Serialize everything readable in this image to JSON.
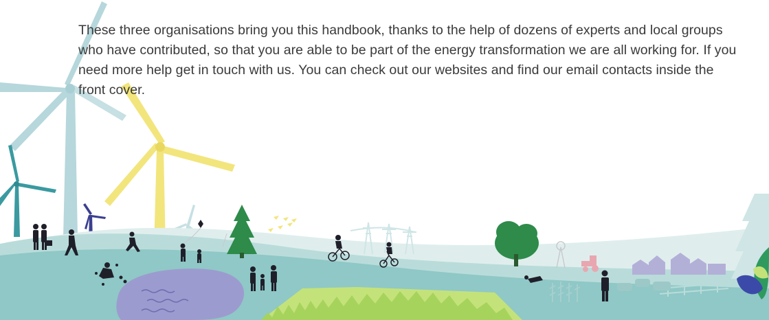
{
  "intro": {
    "text": "These three organisations bring you this handbook, thanks to the help of dozens of experts and local groups who have contributed, so that you are able to be part of the energy transformation we are all working for. If you need more help get in touch with us. You can check out our websites and find our email contacts inside the front cover."
  },
  "colors": {
    "page_background": "#ffffff",
    "text": "#3a3a3a",
    "sky_turbine": "#b6d7db",
    "yellow_turbine": "#f2e57c",
    "teal_turbine": "#3a9aa0",
    "navy_turbine": "#3b3f8f",
    "hill_back": "#dfeeed",
    "hill_mid": "#b9dcda",
    "hill_front": "#8fc8c6",
    "field_green": "#c4e27a",
    "pond": "#9c9bcf",
    "tree": "#2e8b4a",
    "house": "#b3b0d8",
    "tractor": "#e8a7b0",
    "silhouette": "#1f1f2a",
    "pylon": "#cfe5e6"
  },
  "icons": [
    "wind-turbine-icon",
    "tree-icon",
    "person-icon",
    "cyclist-icon",
    "kite-icon",
    "bird-flock-icon",
    "pylon-icon",
    "house-icon",
    "tractor-icon",
    "cow-icon",
    "fence-icon",
    "leaf-icon"
  ]
}
